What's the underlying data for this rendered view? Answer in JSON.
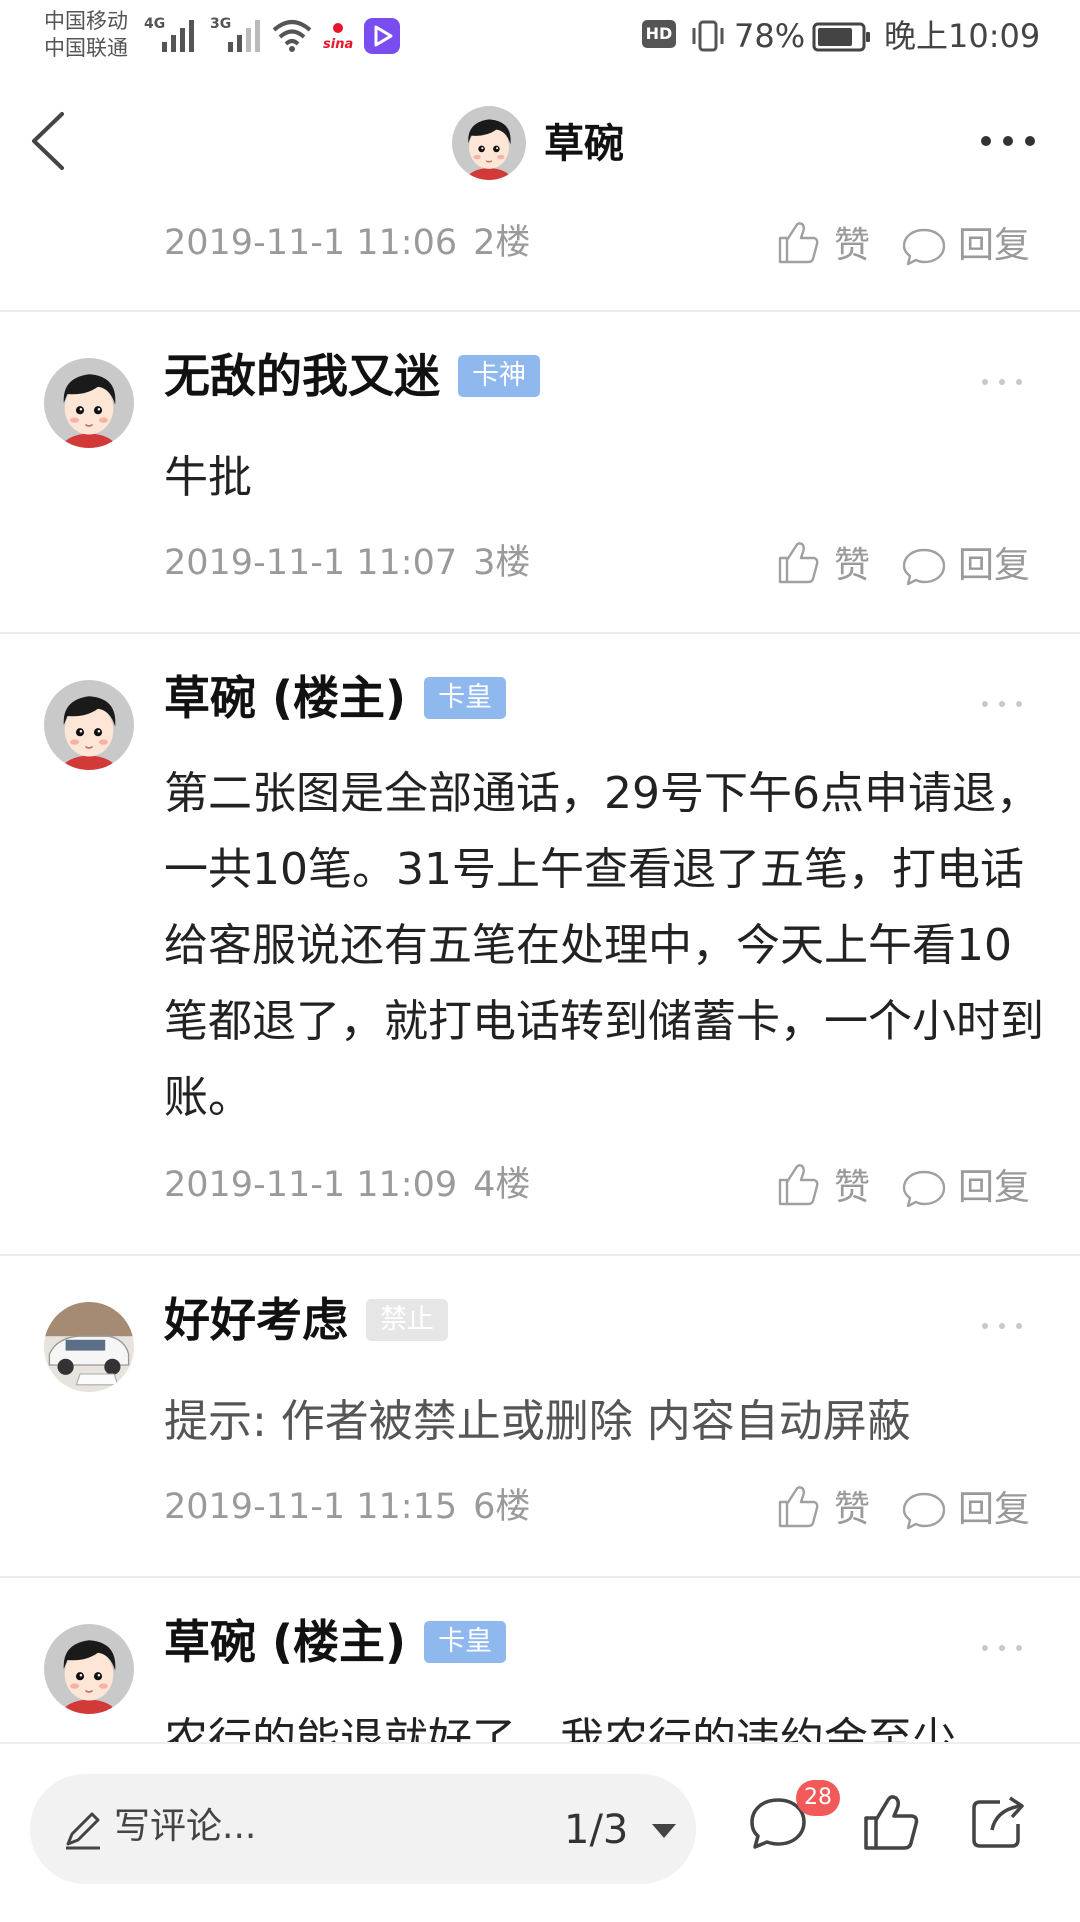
{
  "status_bar": {
    "carrier_1": "中国移动",
    "carrier_2": "中国联通",
    "net_1": "4G",
    "net_2": "3G",
    "hd_label": "HD",
    "battery": "78%",
    "time": "晚上10:09"
  },
  "nav": {
    "title": "草碗",
    "back_icon": "chevron-left-icon",
    "more_icon": "more-horizontal-icon"
  },
  "posts": [
    {
      "time": "2019-11-1 11:06",
      "floor": "2楼",
      "like_label": "赞",
      "reply_label": "回复"
    },
    {
      "username": "无敌的我又迷",
      "badge": "卡神",
      "badge_color": "#8eb8ee",
      "content": "牛批",
      "time": "2019-11-1 11:07",
      "floor": "3楼",
      "like_label": "赞",
      "reply_label": "回复"
    },
    {
      "username": "草碗 (楼主)",
      "badge": "卡皇",
      "badge_color": "#8eb8ee",
      "content": "第二张图是全部通话，29号下午6点申请退，一共10笔。31号上午查看退了五笔，打电话给客服说还有五笔在处理中，今天上午看10笔都退了，就打电话转到储蓄卡，一个小时到账。",
      "time": "2019-11-1 11:09",
      "floor": "4楼",
      "like_label": "赞",
      "reply_label": "回复"
    },
    {
      "username": "好好考虑",
      "badge": "禁止",
      "badge_color": "#e6e6e6",
      "content": "提示: 作者被禁止或删除 内容自动屏蔽",
      "time": "2019-11-1 11:15",
      "floor": "6楼",
      "like_label": "赞",
      "reply_label": "回复"
    },
    {
      "username": "草碗 (楼主)",
      "badge": "卡皇",
      "badge_color": "#8eb8ee",
      "content": "农行的能退就好了，我农行的违约金至少"
    }
  ],
  "bottom_bar": {
    "comment_placeholder": "写评论...",
    "page_indicator": "1/3",
    "comment_count": "28",
    "icons": [
      "pen-icon",
      "comment-icon",
      "thumbs-up-icon",
      "share-icon"
    ]
  },
  "colors": {
    "accent_badge": "#8eb8ee",
    "count_badge": "#f25a5a",
    "meta_text": "#9a9a9a"
  }
}
